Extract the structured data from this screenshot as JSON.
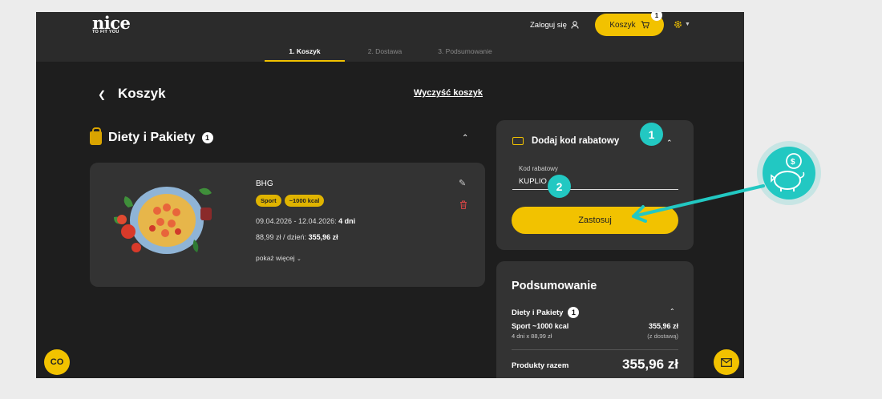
{
  "header": {
    "logo_main": "nice",
    "logo_sub": "TO FIT YOU",
    "login_label": "Zaloguj się",
    "cart_label": "Koszyk",
    "cart_count": "1"
  },
  "steps": [
    {
      "label": "1. Koszyk",
      "active": true
    },
    {
      "label": "2. Dostawa",
      "active": false
    },
    {
      "label": "3. Podsumowanie",
      "active": false
    }
  ],
  "page": {
    "title": "Koszyk",
    "clear_label": "Wyczyść koszyk"
  },
  "cart_section": {
    "title": "Diety i Pakiety",
    "count": "1"
  },
  "product": {
    "name": "BHG",
    "tags": [
      "Sport",
      "~1000 kcal"
    ],
    "dates": "09.04.2026 - 12.04.2026:",
    "days": "4 dni",
    "price_per_day": "88,99 zł / dzień:",
    "total": "355,96 zł",
    "more_label": "pokaż więcej"
  },
  "coupon": {
    "title": "Dodaj kod rabatowy",
    "field_label": "Kod rabatowy",
    "field_value": "KUPLIO",
    "apply_label": "Zastosuj"
  },
  "summary": {
    "title": "Podsumowanie",
    "group_label": "Diety i Pakiety",
    "group_count": "1",
    "item_name": "Sport ~1000 kcal",
    "item_detail": "4 dni x 88,99 zł",
    "item_price": "355,96 zł",
    "item_note": "(z dostawą)",
    "products_total_label": "Produkty razem",
    "products_total_value": "355,96 zł"
  },
  "float_left": {
    "label": "CO"
  },
  "annotations": {
    "marker_1": "1",
    "marker_2": "2",
    "accent_color": "#22c8c2"
  },
  "colors": {
    "brand_yellow": "#f2c200",
    "background": "#1e1e1e",
    "card": "#333333",
    "danger": "#d64545"
  }
}
